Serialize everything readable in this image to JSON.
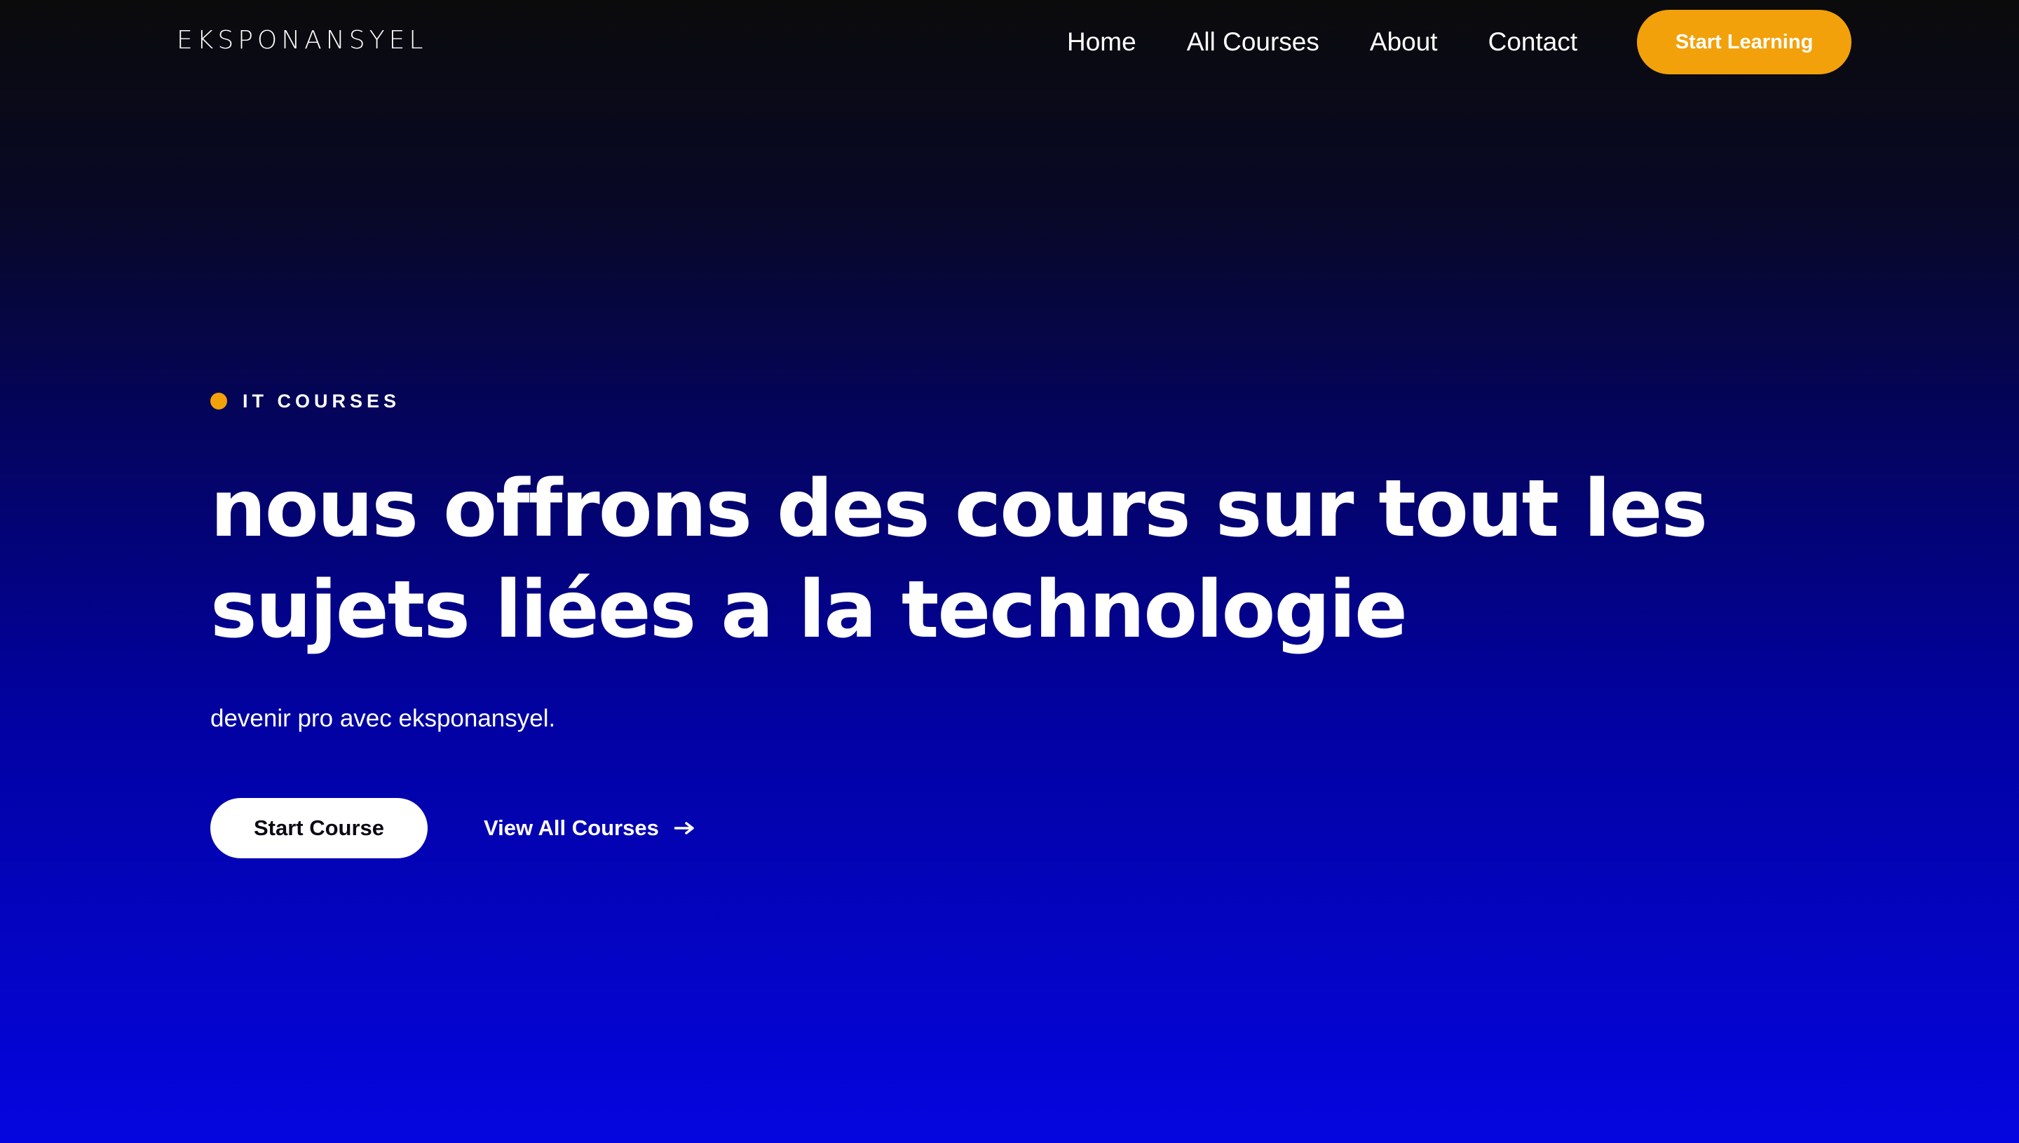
{
  "nav": {
    "logo": "EKSPONANSYEL",
    "links": [
      "Home",
      "All Courses",
      "About",
      "Contact"
    ],
    "cta_label": "Start Learning"
  },
  "hero": {
    "eyebrow": "IT COURSES",
    "headline_lines": [
      "nous offrons des cours sur tout les",
      "sujets liées a la technologie"
    ],
    "subtext": "devenir pro avec eksponansyel.",
    "primary_button": "Start Course",
    "secondary_link": "View All Courses",
    "secondary_icon": "arrow-right-icon"
  },
  "colors": {
    "accent": "#f2a10b",
    "primary_button_bg": "#ffffff",
    "primary_button_text": "#0a0a14",
    "background_top": "#0b0b0c",
    "background_bottom": "#0505e0"
  }
}
